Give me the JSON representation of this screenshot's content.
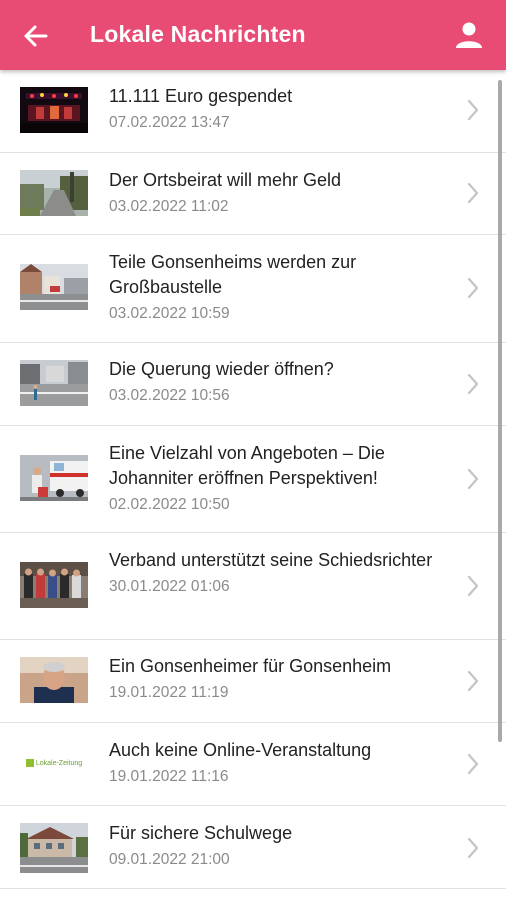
{
  "header": {
    "title": "Lokale Nachrichten",
    "back_icon": "arrow-left-icon",
    "profile_icon": "user-icon",
    "color": "#e84b73"
  },
  "articles": [
    {
      "headline": "11.111 Euro gespendet",
      "date": "07.02.2022 13:47"
    },
    {
      "headline": "Der Ortsbeirat will mehr Geld",
      "date": "03.02.2022 11:02"
    },
    {
      "headline": "Teile Gonsenheims werden zur Großbaustelle",
      "date": "03.02.2022 10:59"
    },
    {
      "headline": "Die Querung wieder öffnen?",
      "date": "03.02.2022 10:56"
    },
    {
      "headline": "Eine Vielzahl von Angeboten – Die Johanniter eröffnen Perspektiven!",
      "date": "02.02.2022 10:50"
    },
    {
      "headline": "Verband unterstützt seine Schiedsrichter",
      "date": "30.01.2022 01:06"
    },
    {
      "headline": "Ein Gonsenheimer für Gonsenheim",
      "date": "19.01.2022 11:19"
    },
    {
      "headline": "Auch keine Online-Veranstaltung",
      "date": "19.01.2022 11:16",
      "thumb_text": "Lokale-Zeitung"
    },
    {
      "headline": "Für sichere Schulwege",
      "date": "09.01.2022 21:00"
    }
  ]
}
